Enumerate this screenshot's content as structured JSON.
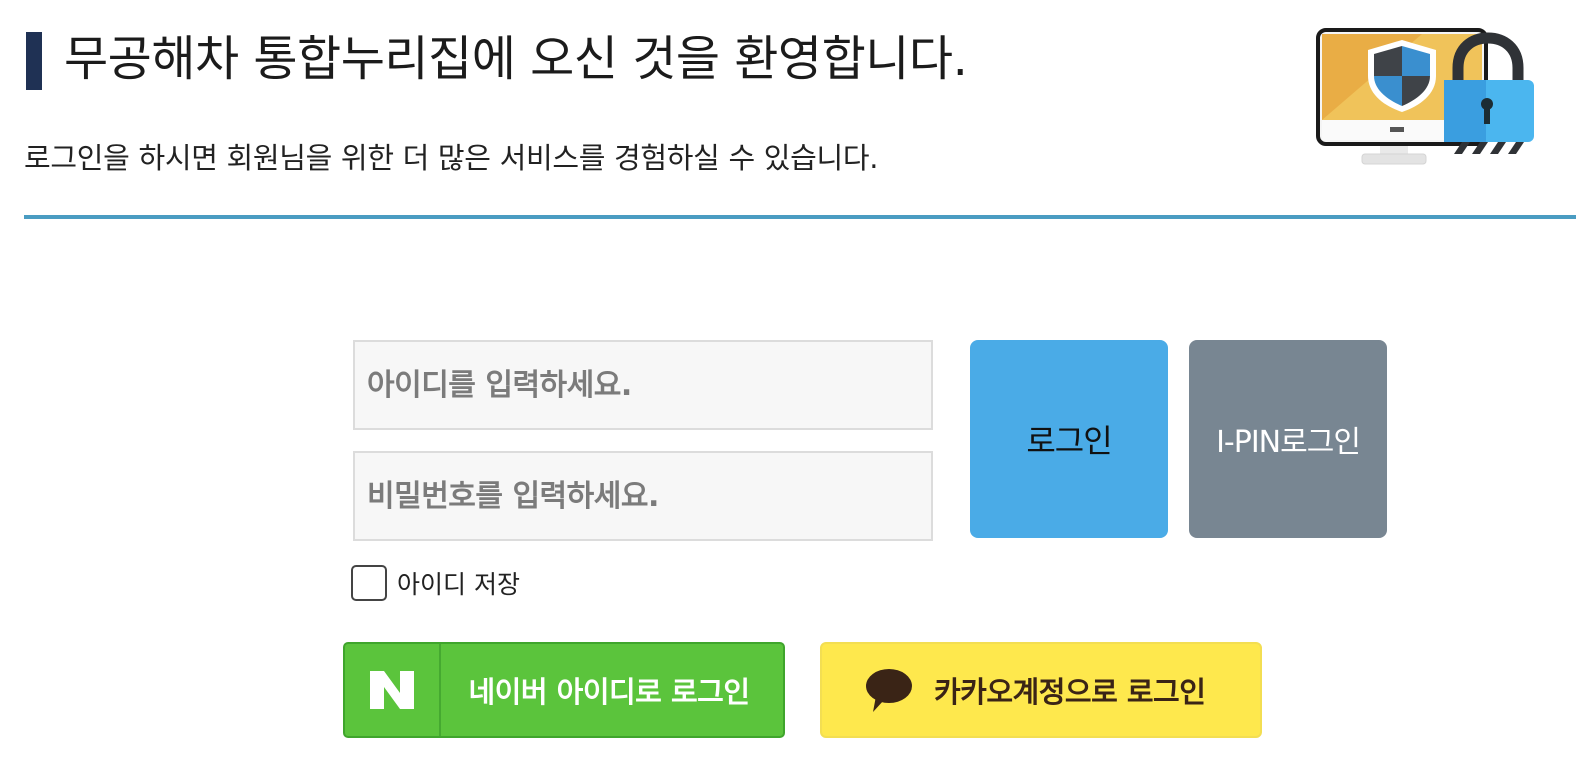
{
  "header": {
    "title": "무공해차 통합누리집에 오신 것을 환영합니다.",
    "subtitle": "로그인을 하시면 회원님을 위한 더 많은 서비스를 경험하실 수 있습니다.",
    "illustration_icon": "security-monitor-lock-icon",
    "accent_color": "#1f3154",
    "divider_color": "#4a9cc2"
  },
  "login_form": {
    "id_placeholder": "아이디를 입력하세요.",
    "id_value": "",
    "password_placeholder": "비밀번호를 입력하세요.",
    "password_value": "",
    "login_label": "로그인",
    "login_color": "#4aabe7",
    "ipin_label": "I-PIN로그인",
    "ipin_color": "#788692",
    "save_id_label": "아이디 저장",
    "save_id_checked": false
  },
  "social_login": {
    "naver": {
      "label": "네이버 아이디로 로그인",
      "icon": "naver-n-icon",
      "color": "#5bc43c"
    },
    "kakao": {
      "label": "카카오계정으로 로그인",
      "icon": "kakao-speech-bubble-icon",
      "color": "#fee84d"
    }
  }
}
